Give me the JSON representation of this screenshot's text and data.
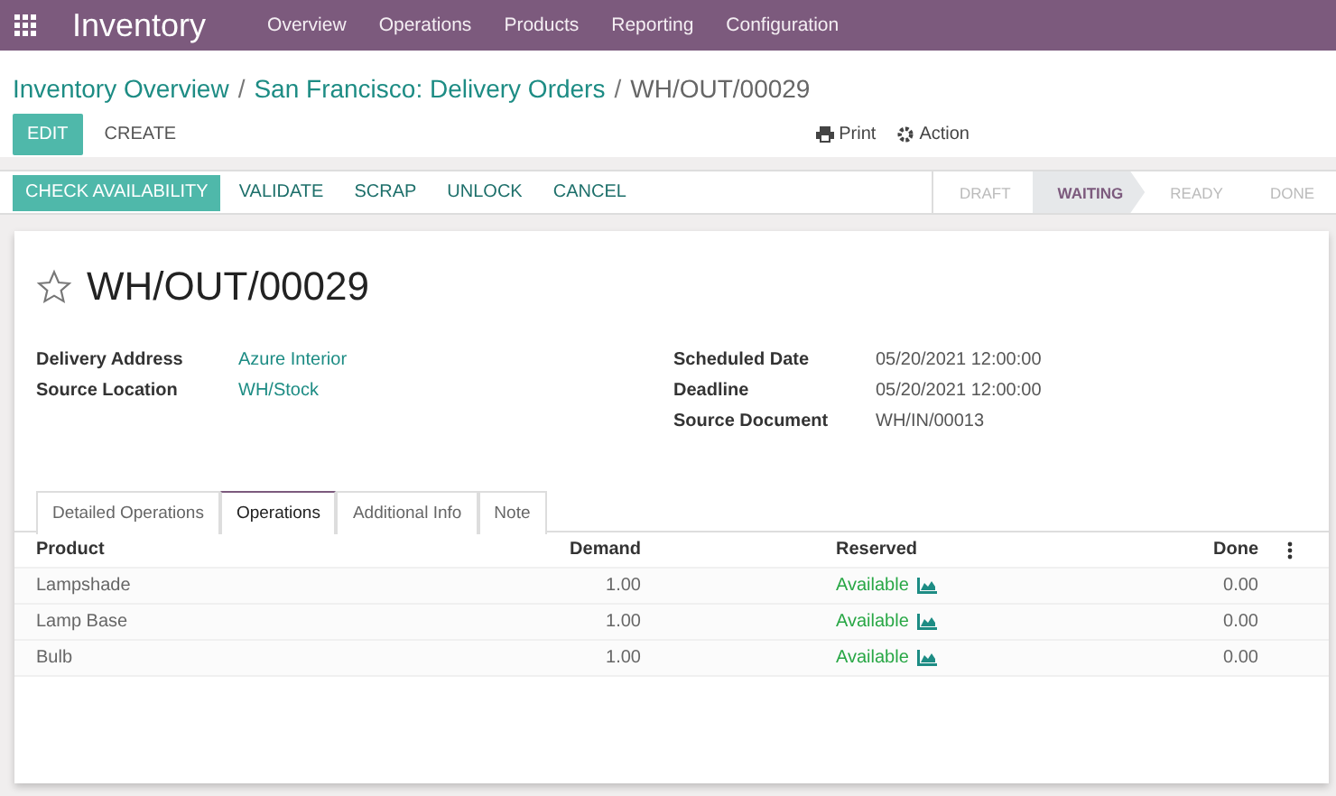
{
  "navbar": {
    "app_title": "Inventory",
    "menu": [
      "Overview",
      "Operations",
      "Products",
      "Reporting",
      "Configuration"
    ]
  },
  "breadcrumb": {
    "links": [
      "Inventory Overview",
      "San Francisco: Delivery Orders"
    ],
    "separator": "/",
    "current": "WH/OUT/00029"
  },
  "control_panel": {
    "edit": "EDIT",
    "create": "CREATE",
    "print": "Print",
    "action": "Action"
  },
  "header_buttons": [
    {
      "label": "CHECK AVAILABILITY",
      "kind": "primary"
    },
    {
      "label": "VALIDATE",
      "kind": "secondary"
    },
    {
      "label": "SCRAP",
      "kind": "secondary"
    },
    {
      "label": "UNLOCK",
      "kind": "secondary"
    },
    {
      "label": "CANCEL",
      "kind": "secondary"
    }
  ],
  "status_steps": [
    {
      "label": "DRAFT",
      "selected": false
    },
    {
      "label": "WAITING",
      "selected": true
    },
    {
      "label": "READY",
      "selected": false
    },
    {
      "label": "DONE",
      "selected": false
    }
  ],
  "record": {
    "title": "WH/OUT/00029",
    "starred": false,
    "left_fields": [
      {
        "label": "Delivery Address",
        "value": "Azure Interior"
      },
      {
        "label": "Source Location",
        "value": "WH/Stock"
      }
    ],
    "right_fields": [
      {
        "label": "Scheduled Date",
        "value": "05/20/2021 12:00:00"
      },
      {
        "label": "Deadline",
        "value": "05/20/2021 12:00:00"
      },
      {
        "label": "Source Document",
        "value": "WH/IN/00013"
      }
    ]
  },
  "tabs": [
    {
      "label": "Detailed Operations",
      "selected": false
    },
    {
      "label": "Operations",
      "selected": true
    },
    {
      "label": "Additional Info",
      "selected": false
    },
    {
      "label": "Note",
      "selected": false
    }
  ],
  "table": {
    "columns": [
      "Product",
      "Demand",
      "Reserved",
      "Done"
    ],
    "rows": [
      {
        "product": "Lampshade",
        "demand": "1.00",
        "reserved": "Available",
        "done": "0.00"
      },
      {
        "product": "Lamp Base",
        "demand": "1.00",
        "reserved": "Available",
        "done": "0.00"
      },
      {
        "product": "Bulb",
        "demand": "1.00",
        "reserved": "Available",
        "done": "0.00"
      }
    ]
  }
}
